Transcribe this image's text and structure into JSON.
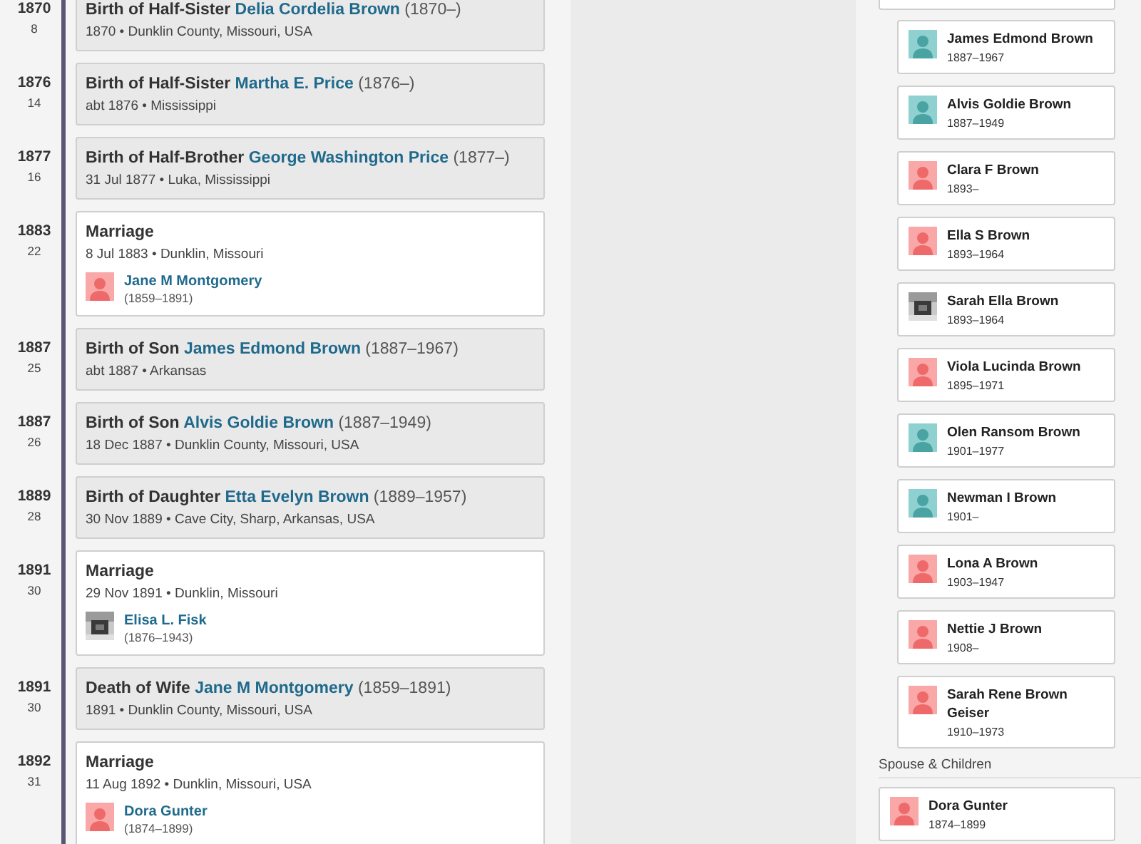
{
  "events": [
    {
      "kind": "relative",
      "year": "1870",
      "age": "8",
      "label": "Birth of Half-Sister",
      "person": "Delia Cordelia Brown",
      "dates": "(1870–)",
      "detail": "1870 • Dunklin County, Missouri, USA"
    },
    {
      "kind": "relative",
      "year": "1876",
      "age": "14",
      "label": "Birth of Half-Sister",
      "person": "Martha E. Price",
      "dates": "(1876–)",
      "detail": "abt 1876 • Mississippi"
    },
    {
      "kind": "relative",
      "year": "1877",
      "age": "16",
      "label": "Birth of Half-Brother",
      "person": "George Washington Price",
      "dates": "(1877–)",
      "detail": "31 Jul 1877 • Luka, Mississippi"
    },
    {
      "kind": "marriage",
      "year": "1883",
      "age": "22",
      "label": "Marriage",
      "detail": "8 Jul 1883 • Dunklin, Missouri",
      "spouse": {
        "name": "Jane M Montgomery",
        "dates": "(1859–1891)",
        "kind": "female"
      }
    },
    {
      "kind": "relative",
      "year": "1887",
      "age": "25",
      "label": "Birth of Son",
      "person": "James Edmond Brown",
      "dates": "(1887–1967)",
      "detail": "abt 1887 • Arkansas"
    },
    {
      "kind": "relative",
      "year": "1887",
      "age": "26",
      "label": "Birth of Son",
      "person": "Alvis Goldie Brown",
      "dates": "(1887–1949)",
      "detail": "18 Dec 1887 • Dunklin County, Missouri, USA"
    },
    {
      "kind": "relative",
      "year": "1889",
      "age": "28",
      "label": "Birth of Daughter",
      "person": "Etta Evelyn Brown",
      "dates": "(1889–1957)",
      "detail": "30 Nov 1889 • Cave City, Sharp, Arkansas, USA"
    },
    {
      "kind": "marriage",
      "year": "1891",
      "age": "30",
      "label": "Marriage",
      "detail": "29 Nov 1891 • Dunklin, Missouri",
      "spouse": {
        "name": "Elisa L. Fisk",
        "dates": "(1876–1943)"
      }
    },
    {
      "kind": "relative",
      "year": "1891",
      "age": "30",
      "label": "Death of Wife",
      "person": "Jane M Montgomery",
      "dates": "(1859–1891)",
      "detail": "1891 • Dunklin County, Missouri, USA"
    },
    {
      "kind": "marriage",
      "year": "1892",
      "age": "31",
      "label": "Marriage",
      "detail": "11 Aug 1892 • Dunklin, Missouri, USA",
      "spouse": {
        "name": "Dora Gunter",
        "dates": "(1874–1899)",
        "kind": "female"
      }
    }
  ],
  "children": [
    {
      "name": "James Edmond Brown",
      "dates": "1887–1967",
      "kind": "male"
    },
    {
      "name": "Alvis Goldie Brown",
      "dates": "1887–1949",
      "kind": "male"
    },
    {
      "name": "Clara F Brown",
      "dates": "1893–",
      "kind": "female"
    },
    {
      "name": "Ella S Brown",
      "dates": "1893–1964",
      "kind": "female"
    },
    {
      "name": "Sarah Ella Brown",
      "dates": "1893–1964"
    },
    {
      "name": "Viola Lucinda Brown",
      "dates": "1895–1971",
      "kind": "female"
    },
    {
      "name": "Olen Ransom Brown",
      "dates": "1901–1977",
      "kind": "male"
    },
    {
      "name": "Newman I Brown",
      "dates": "1901–",
      "kind": "male"
    },
    {
      "name": "Lona A Brown",
      "dates": "1903–1947",
      "kind": "female"
    },
    {
      "name": "Nettie J Brown",
      "dates": "1908–",
      "kind": "female"
    },
    {
      "name": "Sarah Rene Brown Geiser",
      "dates": "1910–1973",
      "kind": "female"
    }
  ],
  "spouse_section": {
    "heading": "Spouse & Children",
    "people": [
      {
        "name": "Dora Gunter",
        "dates": "1874–1899",
        "kind": "female"
      }
    ]
  }
}
